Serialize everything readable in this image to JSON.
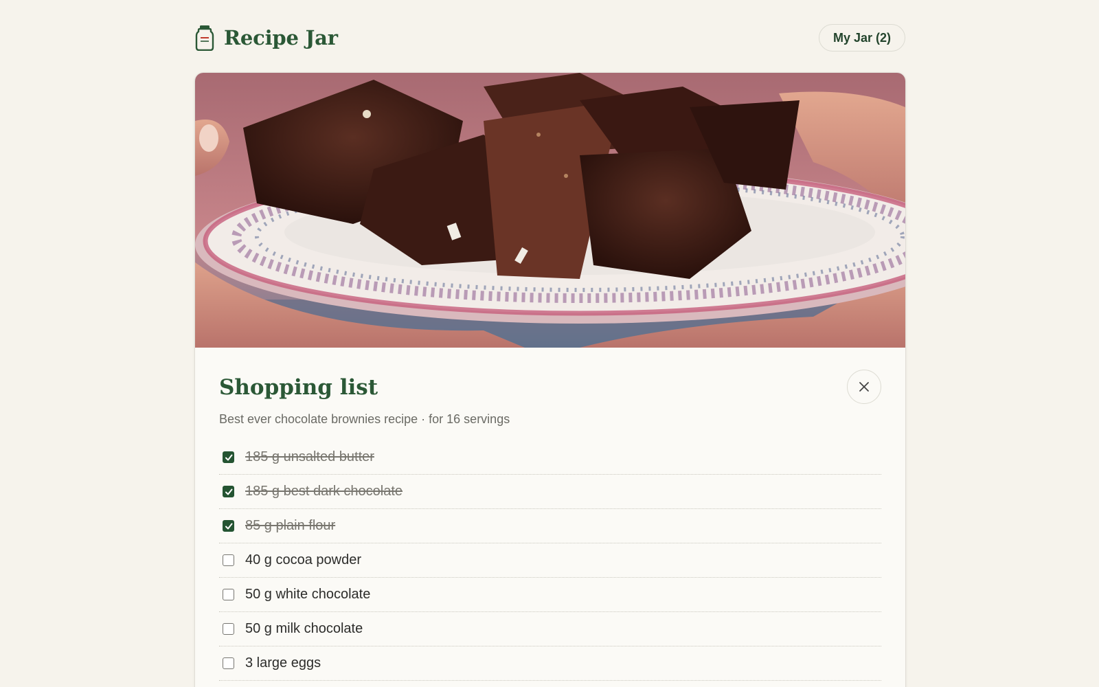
{
  "app": {
    "title": "Recipe Jar",
    "icon": "jar-icon",
    "brand_color": "#2b5836"
  },
  "header": {
    "jar_button_label": "My Jar (2)"
  },
  "hero": {
    "image": "brownies-plate-photo"
  },
  "shopping_list": {
    "title": "Shopping list",
    "subtitle": "Best ever chocolate brownies recipe · for 16 servings",
    "close_icon": "close-icon",
    "items": [
      {
        "label": "185 g unsalted butter",
        "checked": true
      },
      {
        "label": "185 g best dark chocolate",
        "checked": true
      },
      {
        "label": "85 g plain flour",
        "checked": true
      },
      {
        "label": "40 g cocoa powder",
        "checked": false
      },
      {
        "label": "50 g white chocolate",
        "checked": false
      },
      {
        "label": "50 g milk chocolate",
        "checked": false
      },
      {
        "label": "3 large eggs",
        "checked": false
      }
    ]
  },
  "colors": {
    "background": "#f6f3ec",
    "accent_green": "#245432",
    "card": "#fbfaf6"
  }
}
